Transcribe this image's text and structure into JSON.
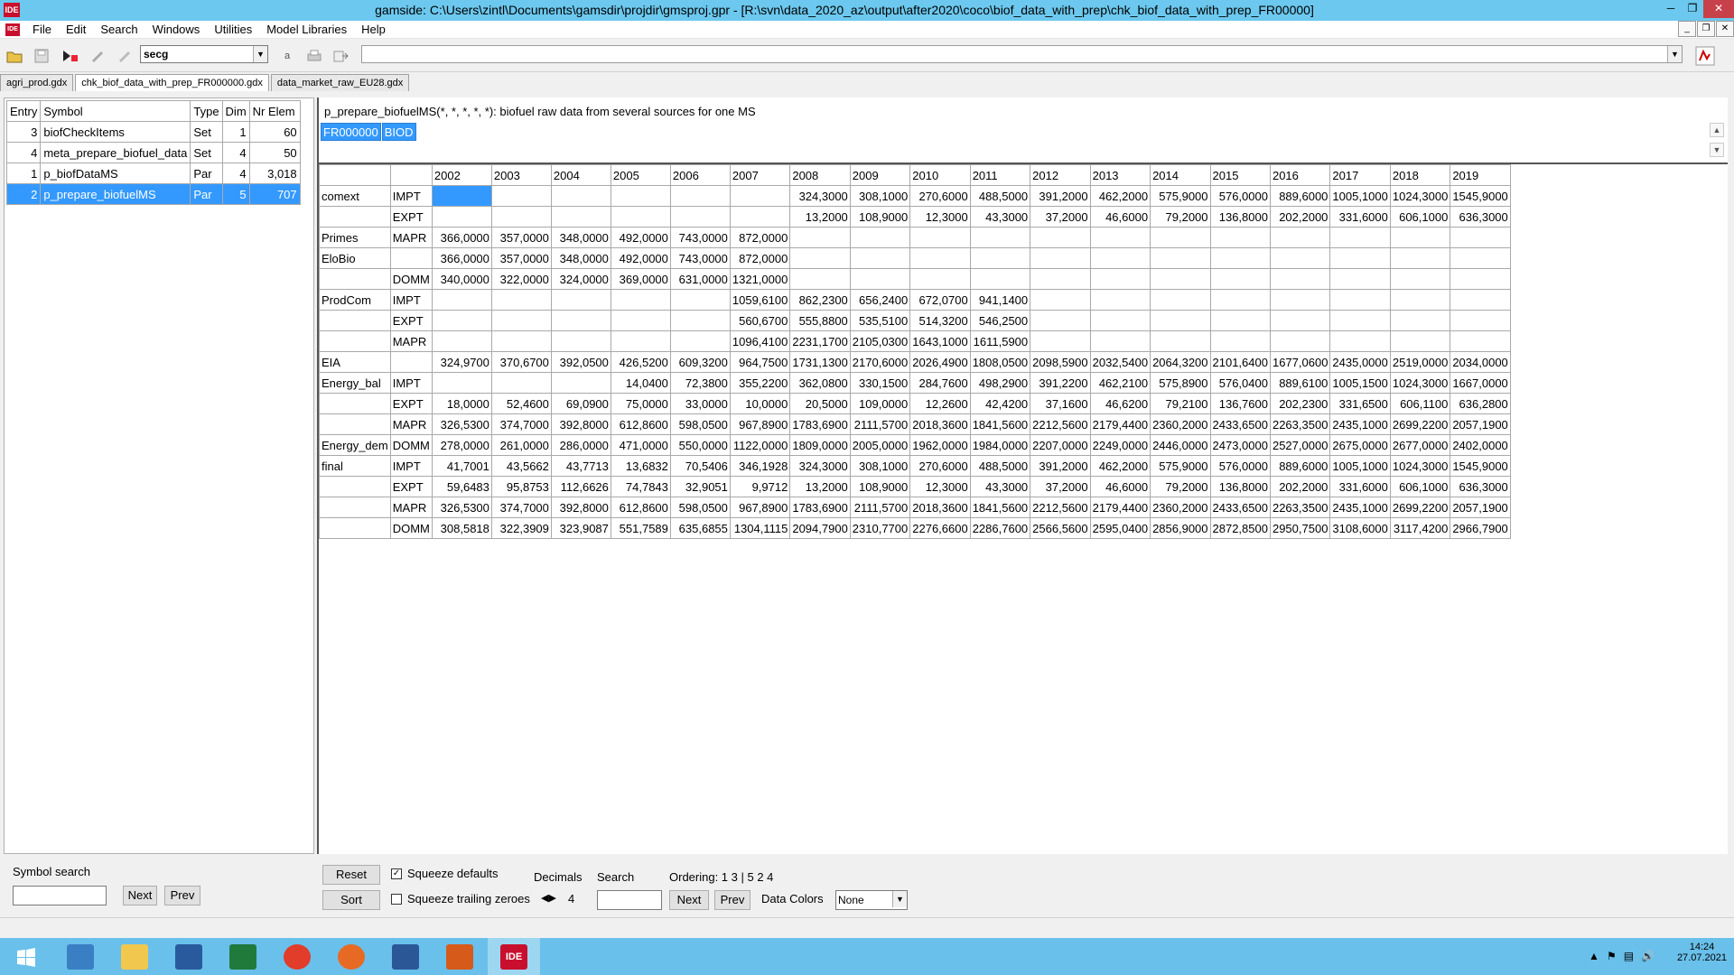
{
  "window": {
    "title": "gamside: C:\\Users\\zintl\\Documents\\gamsdir\\projdir\\gmsproj.gpr - [R:\\svn\\data_2020_az\\output\\after2020\\coco\\biof_data_with_prep\\chk_biof_data_with_prep_FR00000]",
    "app_icon": "IDE"
  },
  "menu": [
    "File",
    "Edit",
    "Search",
    "Windows",
    "Utilities",
    "Model Libraries",
    "Help"
  ],
  "toolbar": {
    "combo_value": "secg",
    "letter_a": "a"
  },
  "tabs": [
    {
      "label": "agri_prod.gdx",
      "active": false
    },
    {
      "label": "chk_biof_data_with_prep_FR000000.gdx",
      "active": true
    },
    {
      "label": "data_market_raw_EU28.gdx",
      "active": false
    }
  ],
  "symbols": {
    "headers": [
      "Entry",
      "Symbol",
      "Type",
      "Dim",
      "Nr Elem"
    ],
    "rows": [
      {
        "entry": "3",
        "symbol": "biofCheckItems",
        "type": "Set",
        "dim": "1",
        "nr": "60",
        "selected": false
      },
      {
        "entry": "4",
        "symbol": "meta_prepare_biofuel_data",
        "type": "Set",
        "dim": "4",
        "nr": "50",
        "selected": false
      },
      {
        "entry": "1",
        "symbol": "p_biofDataMS",
        "type": "Par",
        "dim": "4",
        "nr": "3,018",
        "selected": false
      },
      {
        "entry": "2",
        "symbol": "p_prepare_biofuelMS",
        "type": "Par",
        "dim": "5",
        "nr": "707",
        "selected": true
      }
    ]
  },
  "symbol_search": {
    "label": "Symbol search",
    "next": "Next",
    "prev": "Prev",
    "value": ""
  },
  "view": {
    "title": "p_prepare_biofuelMS(*, *, *, *, *): biofuel raw data from several sources for one MS",
    "filters": [
      "FR000000",
      "BIOD"
    ],
    "years": [
      "2002",
      "2003",
      "2004",
      "2005",
      "2006",
      "2007",
      "2008",
      "2009",
      "2010",
      "2011",
      "2012",
      "2013",
      "2014",
      "2015",
      "2016",
      "2017",
      "2018",
      "2019"
    ],
    "rows": [
      {
        "r1": "comext",
        "r2": "IMPT",
        "v": [
          "",
          "",
          "",
          "",
          "",
          "",
          "324,3000",
          "308,1000",
          "270,6000",
          "488,5000",
          "391,2000",
          "462,2000",
          "575,9000",
          "576,0000",
          "889,6000",
          "1005,1000",
          "1024,3000",
          "1545,9000"
        ]
      },
      {
        "r1": "",
        "r2": "EXPT",
        "v": [
          "",
          "",
          "",
          "",
          "",
          "",
          "13,2000",
          "108,9000",
          "12,3000",
          "43,3000",
          "37,2000",
          "46,6000",
          "79,2000",
          "136,8000",
          "202,2000",
          "331,6000",
          "606,1000",
          "636,3000"
        ]
      },
      {
        "r1": "Primes",
        "r2": "MAPR",
        "v": [
          "366,0000",
          "357,0000",
          "348,0000",
          "492,0000",
          "743,0000",
          "872,0000",
          "",
          "",
          "",
          "",
          "",
          "",
          "",
          "",
          "",
          "",
          "",
          ""
        ]
      },
      {
        "r1": "EloBio",
        "r2": "",
        "v": [
          "366,0000",
          "357,0000",
          "348,0000",
          "492,0000",
          "743,0000",
          "872,0000",
          "",
          "",
          "",
          "",
          "",
          "",
          "",
          "",
          "",
          "",
          "",
          ""
        ]
      },
      {
        "r1": "",
        "r2": "DOMM",
        "v": [
          "340,0000",
          "322,0000",
          "324,0000",
          "369,0000",
          "631,0000",
          "1321,0000",
          "",
          "",
          "",
          "",
          "",
          "",
          "",
          "",
          "",
          "",
          "",
          ""
        ]
      },
      {
        "r1": "ProdCom",
        "r2": "IMPT",
        "v": [
          "",
          "",
          "",
          "",
          "",
          "1059,6100",
          "862,2300",
          "656,2400",
          "672,0700",
          "941,1400",
          "",
          "",
          "",
          "",
          "",
          "",
          "",
          ""
        ]
      },
      {
        "r1": "",
        "r2": "EXPT",
        "v": [
          "",
          "",
          "",
          "",
          "",
          "560,6700",
          "555,8800",
          "535,5100",
          "514,3200",
          "546,2500",
          "",
          "",
          "",
          "",
          "",
          "",
          "",
          ""
        ]
      },
      {
        "r1": "",
        "r2": "MAPR",
        "v": [
          "",
          "",
          "",
          "",
          "",
          "1096,4100",
          "2231,1700",
          "2105,0300",
          "1643,1000",
          "1611,5900",
          "",
          "",
          "",
          "",
          "",
          "",
          "",
          ""
        ]
      },
      {
        "r1": "EIA",
        "r2": "",
        "v": [
          "324,9700",
          "370,6700",
          "392,0500",
          "426,5200",
          "609,3200",
          "964,7500",
          "1731,1300",
          "2170,6000",
          "2026,4900",
          "1808,0500",
          "2098,5900",
          "2032,5400",
          "2064,3200",
          "2101,6400",
          "1677,0600",
          "2435,0000",
          "2519,0000",
          "2034,0000"
        ]
      },
      {
        "r1": "Energy_bal",
        "r2": "IMPT",
        "v": [
          "",
          "",
          "",
          "14,0400",
          "72,3800",
          "355,2200",
          "362,0800",
          "330,1500",
          "284,7600",
          "498,2900",
          "391,2200",
          "462,2100",
          "575,8900",
          "576,0400",
          "889,6100",
          "1005,1500",
          "1024,3000",
          "1667,0000"
        ]
      },
      {
        "r1": "",
        "r2": "EXPT",
        "v": [
          "18,0000",
          "52,4600",
          "69,0900",
          "75,0000",
          "33,0000",
          "10,0000",
          "20,5000",
          "109,0000",
          "12,2600",
          "42,4200",
          "37,1600",
          "46,6200",
          "79,2100",
          "136,7600",
          "202,2300",
          "331,6500",
          "606,1100",
          "636,2800"
        ]
      },
      {
        "r1": "",
        "r2": "MAPR",
        "v": [
          "326,5300",
          "374,7000",
          "392,8000",
          "612,8600",
          "598,0500",
          "967,8900",
          "1783,6900",
          "2111,5700",
          "2018,3600",
          "1841,5600",
          "2212,5600",
          "2179,4400",
          "2360,2000",
          "2433,6500",
          "2263,3500",
          "2435,1000",
          "2699,2200",
          "2057,1900"
        ]
      },
      {
        "r1": "Energy_dem",
        "r2": "DOMM",
        "v": [
          "278,0000",
          "261,0000",
          "286,0000",
          "471,0000",
          "550,0000",
          "1122,0000",
          "1809,0000",
          "2005,0000",
          "1962,0000",
          "1984,0000",
          "2207,0000",
          "2249,0000",
          "2446,0000",
          "2473,0000",
          "2527,0000",
          "2675,0000",
          "2677,0000",
          "2402,0000"
        ]
      },
      {
        "r1": "final",
        "r2": "IMPT",
        "v": [
          "41,7001",
          "43,5662",
          "43,7713",
          "13,6832",
          "70,5406",
          "346,1928",
          "324,3000",
          "308,1000",
          "270,6000",
          "488,5000",
          "391,2000",
          "462,2000",
          "575,9000",
          "576,0000",
          "889,6000",
          "1005,1000",
          "1024,3000",
          "1545,9000"
        ]
      },
      {
        "r1": "",
        "r2": "EXPT",
        "v": [
          "59,6483",
          "95,8753",
          "112,6626",
          "74,7843",
          "32,9051",
          "9,9712",
          "13,2000",
          "108,9000",
          "12,3000",
          "43,3000",
          "37,2000",
          "46,6000",
          "79,2000",
          "136,8000",
          "202,2000",
          "331,6000",
          "606,1000",
          "636,3000"
        ]
      },
      {
        "r1": "",
        "r2": "MAPR",
        "v": [
          "326,5300",
          "374,7000",
          "392,8000",
          "612,8600",
          "598,0500",
          "967,8900",
          "1783,6900",
          "2111,5700",
          "2018,3600",
          "1841,5600",
          "2212,5600",
          "2179,4400",
          "2360,2000",
          "2433,6500",
          "2263,3500",
          "2435,1000",
          "2699,2200",
          "2057,1900"
        ]
      },
      {
        "r1": "",
        "r2": "DOMM",
        "v": [
          "308,5818",
          "322,3909",
          "323,9087",
          "551,7589",
          "635,6855",
          "1304,1115",
          "2094,7900",
          "2310,7700",
          "2276,6600",
          "2286,7600",
          "2566,5600",
          "2595,0400",
          "2856,9000",
          "2872,8500",
          "2950,7500",
          "3108,6000",
          "3117,4200",
          "2966,7900"
        ]
      }
    ]
  },
  "controls": {
    "reset": "Reset",
    "sort": "Sort",
    "squeeze_defaults": "Squeeze defaults",
    "squeeze_defaults_checked": true,
    "squeeze_trailing": "Squeeze trailing zeroes",
    "squeeze_trailing_checked": false,
    "decimals_label": "Decimals",
    "decimals_value": "4",
    "search_label": "Search",
    "search_value": "",
    "next": "Next",
    "prev": "Prev",
    "ordering": "Ordering: 1 3 | 5 2 4",
    "data_colors_label": "Data Colors",
    "data_colors_value": "None"
  },
  "taskbar": {
    "time": "14:24",
    "date": "27.07.2021",
    "active_app": "IDE"
  }
}
